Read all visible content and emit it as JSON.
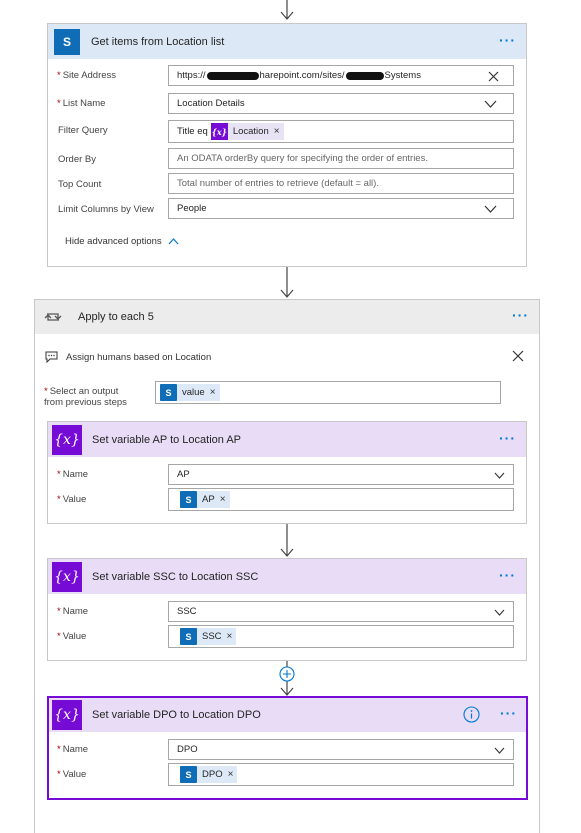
{
  "get_items": {
    "title": "Get items from Location list",
    "site_address_label": "Site Address",
    "site_address_value_prefix": "https://",
    "site_address_value_middle": "harepoint.com/sites/",
    "site_address_value_suffix": "Systems",
    "list_name_label": "List Name",
    "list_name_value": "Location Details",
    "filter_query_label": "Filter Query",
    "filter_query_prefix": "Title eq",
    "filter_query_token": "Location",
    "order_by_label": "Order By",
    "order_by_placeholder": "An ODATA orderBy query for specifying the order of entries.",
    "top_count_label": "Top Count",
    "top_count_placeholder": "Total number of entries to retrieve (default = all).",
    "limit_columns_label": "Limit Columns by View",
    "limit_columns_value": "People",
    "hide_advanced_label": "Hide advanced options"
  },
  "apply_each": {
    "title": "Apply to each 5",
    "comment": "Assign humans based on Location",
    "select_output_label_1": "Select an output",
    "select_output_label_2": "from previous steps",
    "select_output_token": "value"
  },
  "set_ap": {
    "title": "Set variable AP to Location AP",
    "name_label": "Name",
    "name_value": "AP",
    "value_label": "Value",
    "value_token": "AP"
  },
  "set_ssc": {
    "title": "Set variable SSC to Location SSC",
    "name_label": "Name",
    "name_value": "SSC",
    "value_label": "Value",
    "value_token": "SSC"
  },
  "set_dpo": {
    "title": "Set variable DPO to Location DPO",
    "name_label": "Name",
    "name_value": "DPO",
    "value_label": "Value",
    "value_token": "DPO"
  },
  "common": {
    "required_mark": "*",
    "more_dots": "···",
    "chip_close": "×",
    "var_symbol": "{x}",
    "sp_letter": "S"
  },
  "colors": {
    "sharepoint_header": "#dce8f5",
    "variable_header": "#e8dcf6",
    "apply_header": "#ececec",
    "variable_accent": "#770bd6",
    "sharepoint_accent": "#0f6db8",
    "link_blue": "#0078d4"
  }
}
